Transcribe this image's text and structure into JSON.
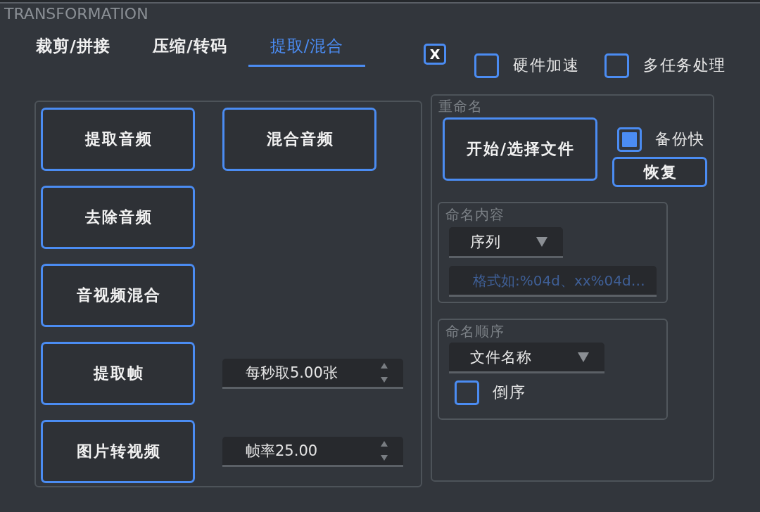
{
  "window": {
    "title": "TRANSFORMATION"
  },
  "tabs": [
    {
      "label": "裁剪/拼接",
      "selected": false
    },
    {
      "label": "压缩/转码",
      "selected": false
    },
    {
      "label": "提取/混合",
      "selected": true
    }
  ],
  "toolbar": {
    "close_button": "X",
    "checkboxes": [
      {
        "label": "硬件加速",
        "checked": false
      },
      {
        "label": "多任务处理",
        "checked": false
      }
    ]
  },
  "extract_panel": {
    "rows": [
      {
        "items": [
          {
            "kind": "button",
            "label": "提取音频"
          },
          {
            "kind": "button",
            "label": "混合音频"
          }
        ]
      },
      {
        "items": [
          {
            "kind": "button",
            "label": "去除音频"
          }
        ]
      },
      {
        "items": [
          {
            "kind": "button",
            "label": "音视频混合"
          }
        ]
      },
      {
        "items": [
          {
            "kind": "button",
            "label": "提取帧"
          },
          {
            "kind": "spinbox",
            "value": "每秒取5.00张"
          }
        ]
      },
      {
        "items": [
          {
            "kind": "button",
            "label": "图片转视频"
          },
          {
            "kind": "spinbox",
            "value": "帧率25.00"
          }
        ]
      }
    ]
  },
  "rename_panel": {
    "title": "重命名",
    "start_button": "开始/选择文件",
    "backup": {
      "label": "备份快",
      "checked": true
    },
    "restore_button": "恢复",
    "naming_content": {
      "title": "命名内容",
      "dropdown": "序列",
      "field": {
        "placeholder": "格式如:%04d、xx%04d…"
      }
    },
    "naming_order": {
      "title": "命名顺序",
      "dropdown": "文件名称",
      "reverse": {
        "label": "倒序",
        "checked": false
      }
    }
  }
}
